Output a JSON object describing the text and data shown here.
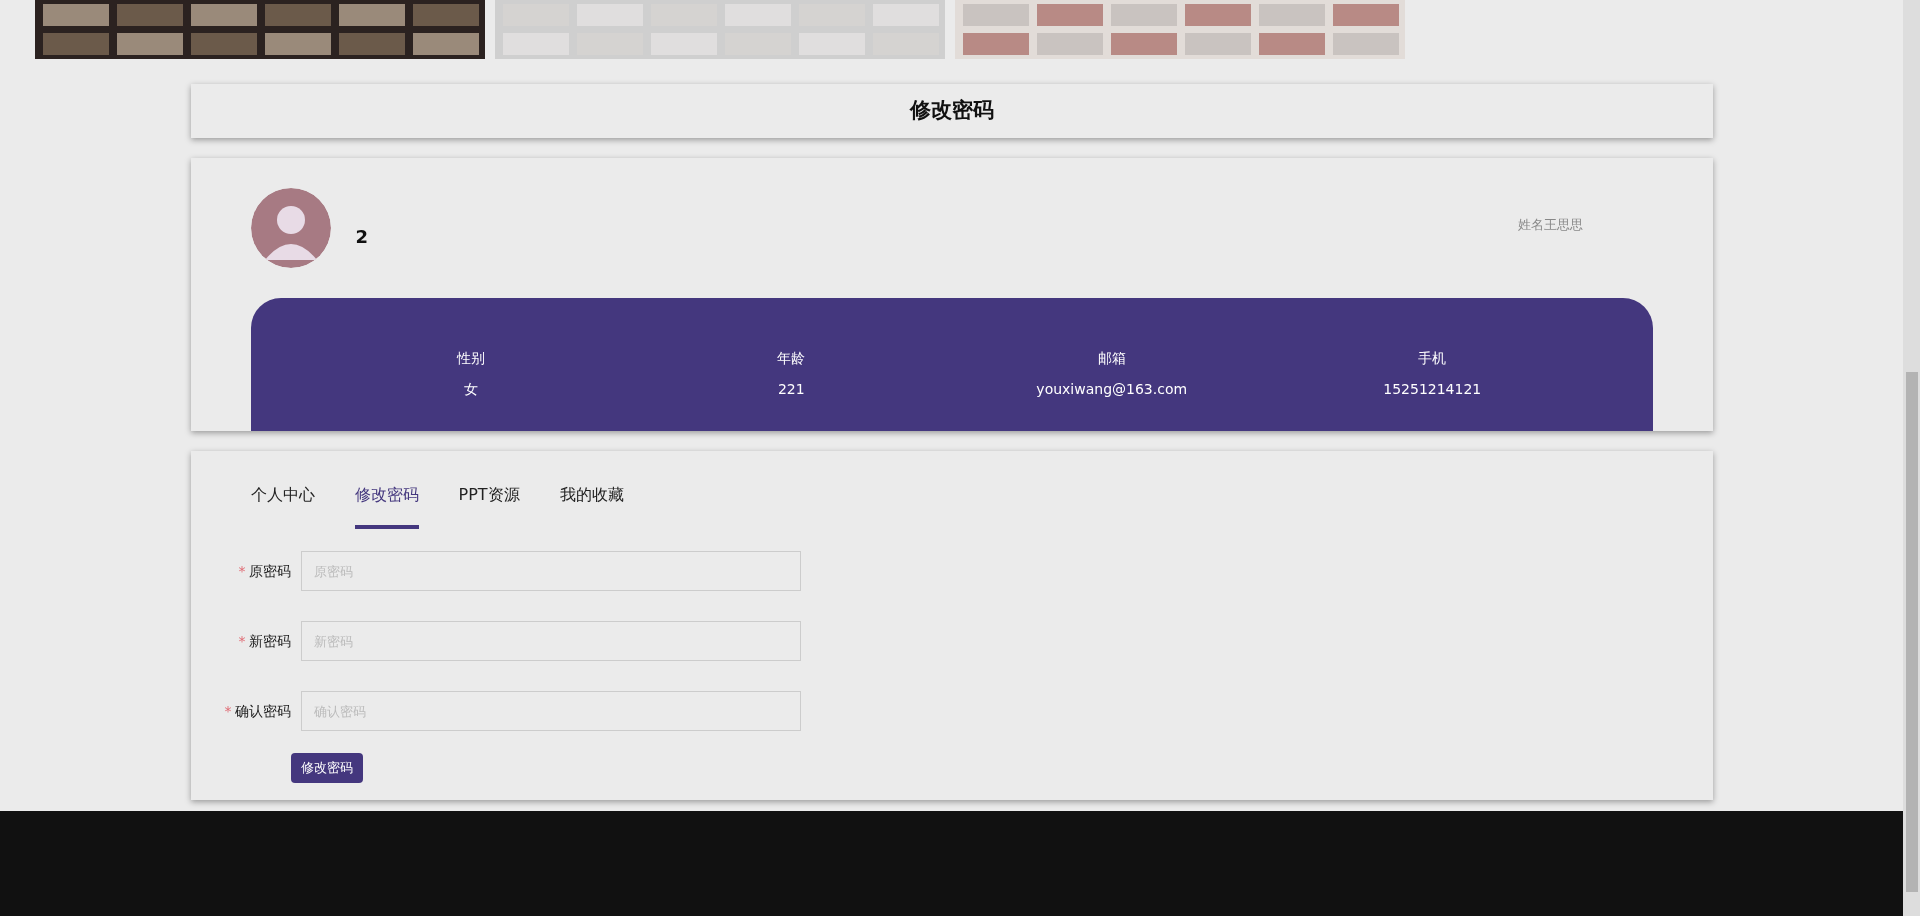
{
  "page_title": "修改密码",
  "profile": {
    "username": "2",
    "name": "姓名王思思",
    "stats": [
      {
        "label": "性别",
        "value": "女"
      },
      {
        "label": "年龄",
        "value": "221"
      },
      {
        "label": "邮箱",
        "value": "youxiwang@163.com"
      },
      {
        "label": "手机",
        "value": "15251214121"
      }
    ]
  },
  "tabs": [
    {
      "label": "个人中心",
      "selected": false
    },
    {
      "label": "修改密码",
      "selected": true
    },
    {
      "label": "PPT资源",
      "selected": false
    },
    {
      "label": "我的收藏",
      "selected": false
    }
  ],
  "form": {
    "fields": [
      {
        "label": "原密码",
        "required_mark": "*",
        "placeholder": "原密码"
      },
      {
        "label": "新密码",
        "required_mark": "*",
        "placeholder": "新密码"
      },
      {
        "label": "确认密码",
        "required_mark": "*",
        "placeholder": "确认密码"
      }
    ],
    "submit": "修改密码"
  }
}
